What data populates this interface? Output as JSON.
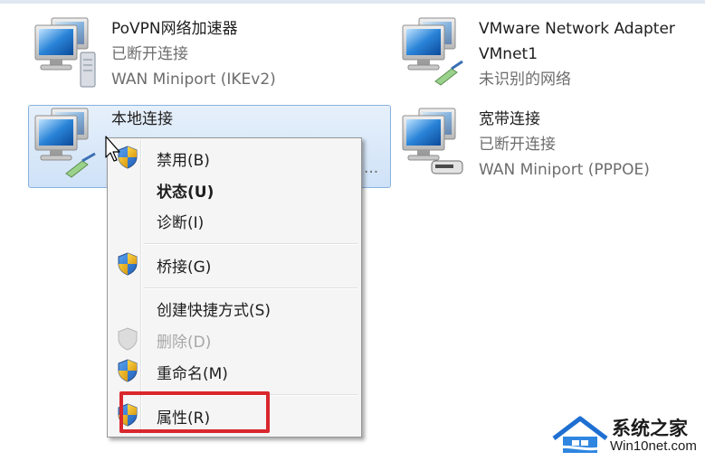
{
  "adapters": [
    {
      "name": "PoVPN网络加速器",
      "status": "已断开连接",
      "device": "WAN Miniport (IKEv2)",
      "icon": "vpn-connection-icon"
    },
    {
      "name": "VMware Network Adapter",
      "name2": "VMnet1",
      "status": "未识别的网络",
      "icon": "network-adapter-icon"
    },
    {
      "name": "本地连接",
      "icon": "local-connection-icon"
    },
    {
      "name": "宽带连接",
      "status": "已断开连接",
      "device": "WAN Miniport (PPPOE)",
      "icon": "broadband-connection-icon"
    }
  ],
  "truncation": "...",
  "context_menu": {
    "items": [
      {
        "label": "禁用(B)",
        "icon": "uac-shield-icon"
      },
      {
        "label": "状态(U)",
        "default": true
      },
      {
        "label": "诊断(I)"
      },
      {
        "label": "桥接(G)",
        "icon": "uac-shield-icon"
      },
      {
        "label": "创建快捷方式(S)"
      },
      {
        "label": "删除(D)",
        "icon": "uac-shield-icon",
        "disabled": true
      },
      {
        "label": "重命名(M)",
        "icon": "uac-shield-icon"
      },
      {
        "label": "属性(R)",
        "icon": "uac-shield-icon"
      }
    ]
  },
  "watermark": {
    "title": "系统之家",
    "site": "Win10net.com"
  },
  "colors": {
    "highlight": "#d9272d",
    "selection": "#cfe2f7",
    "menu_bg": "#f5f5f5"
  }
}
